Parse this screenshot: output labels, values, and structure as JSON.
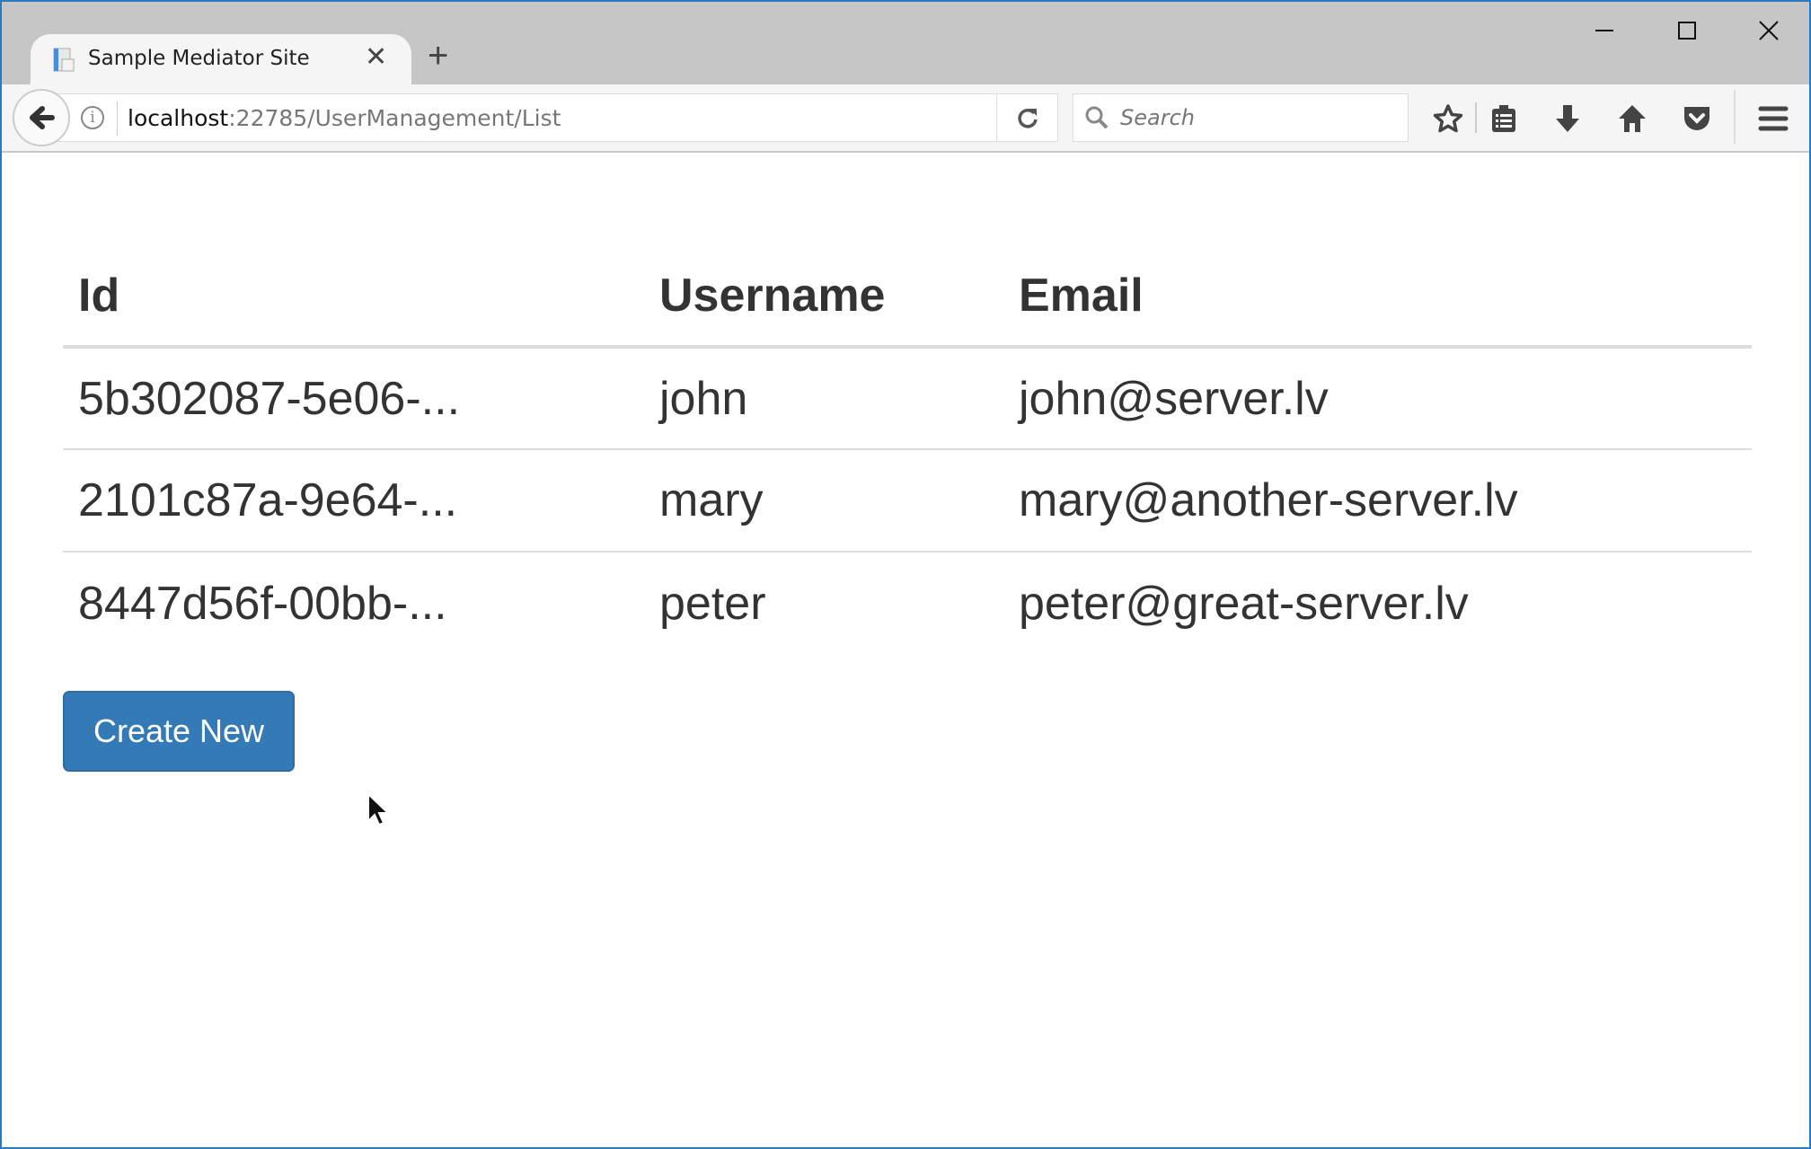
{
  "browser": {
    "tab_title": "Sample Mediator Site",
    "url_host": "localhost",
    "url_rest": ":22785/UserManagement/List",
    "search_placeholder": "Search"
  },
  "table": {
    "headers": [
      "Id",
      "Username",
      "Email"
    ],
    "rows": [
      [
        "5b302087-5e06-...",
        "john",
        "john@server.lv"
      ],
      [
        "2101c87a-9e64-...",
        "mary",
        "mary@another-server.lv"
      ],
      [
        "8447d56f-00bb-...",
        "peter",
        "peter@great-server.lv"
      ]
    ]
  },
  "create_button": "Create New",
  "colors": {
    "accent": "#337ab7",
    "tabbar": "#c6c6c6",
    "text": "#333333"
  }
}
